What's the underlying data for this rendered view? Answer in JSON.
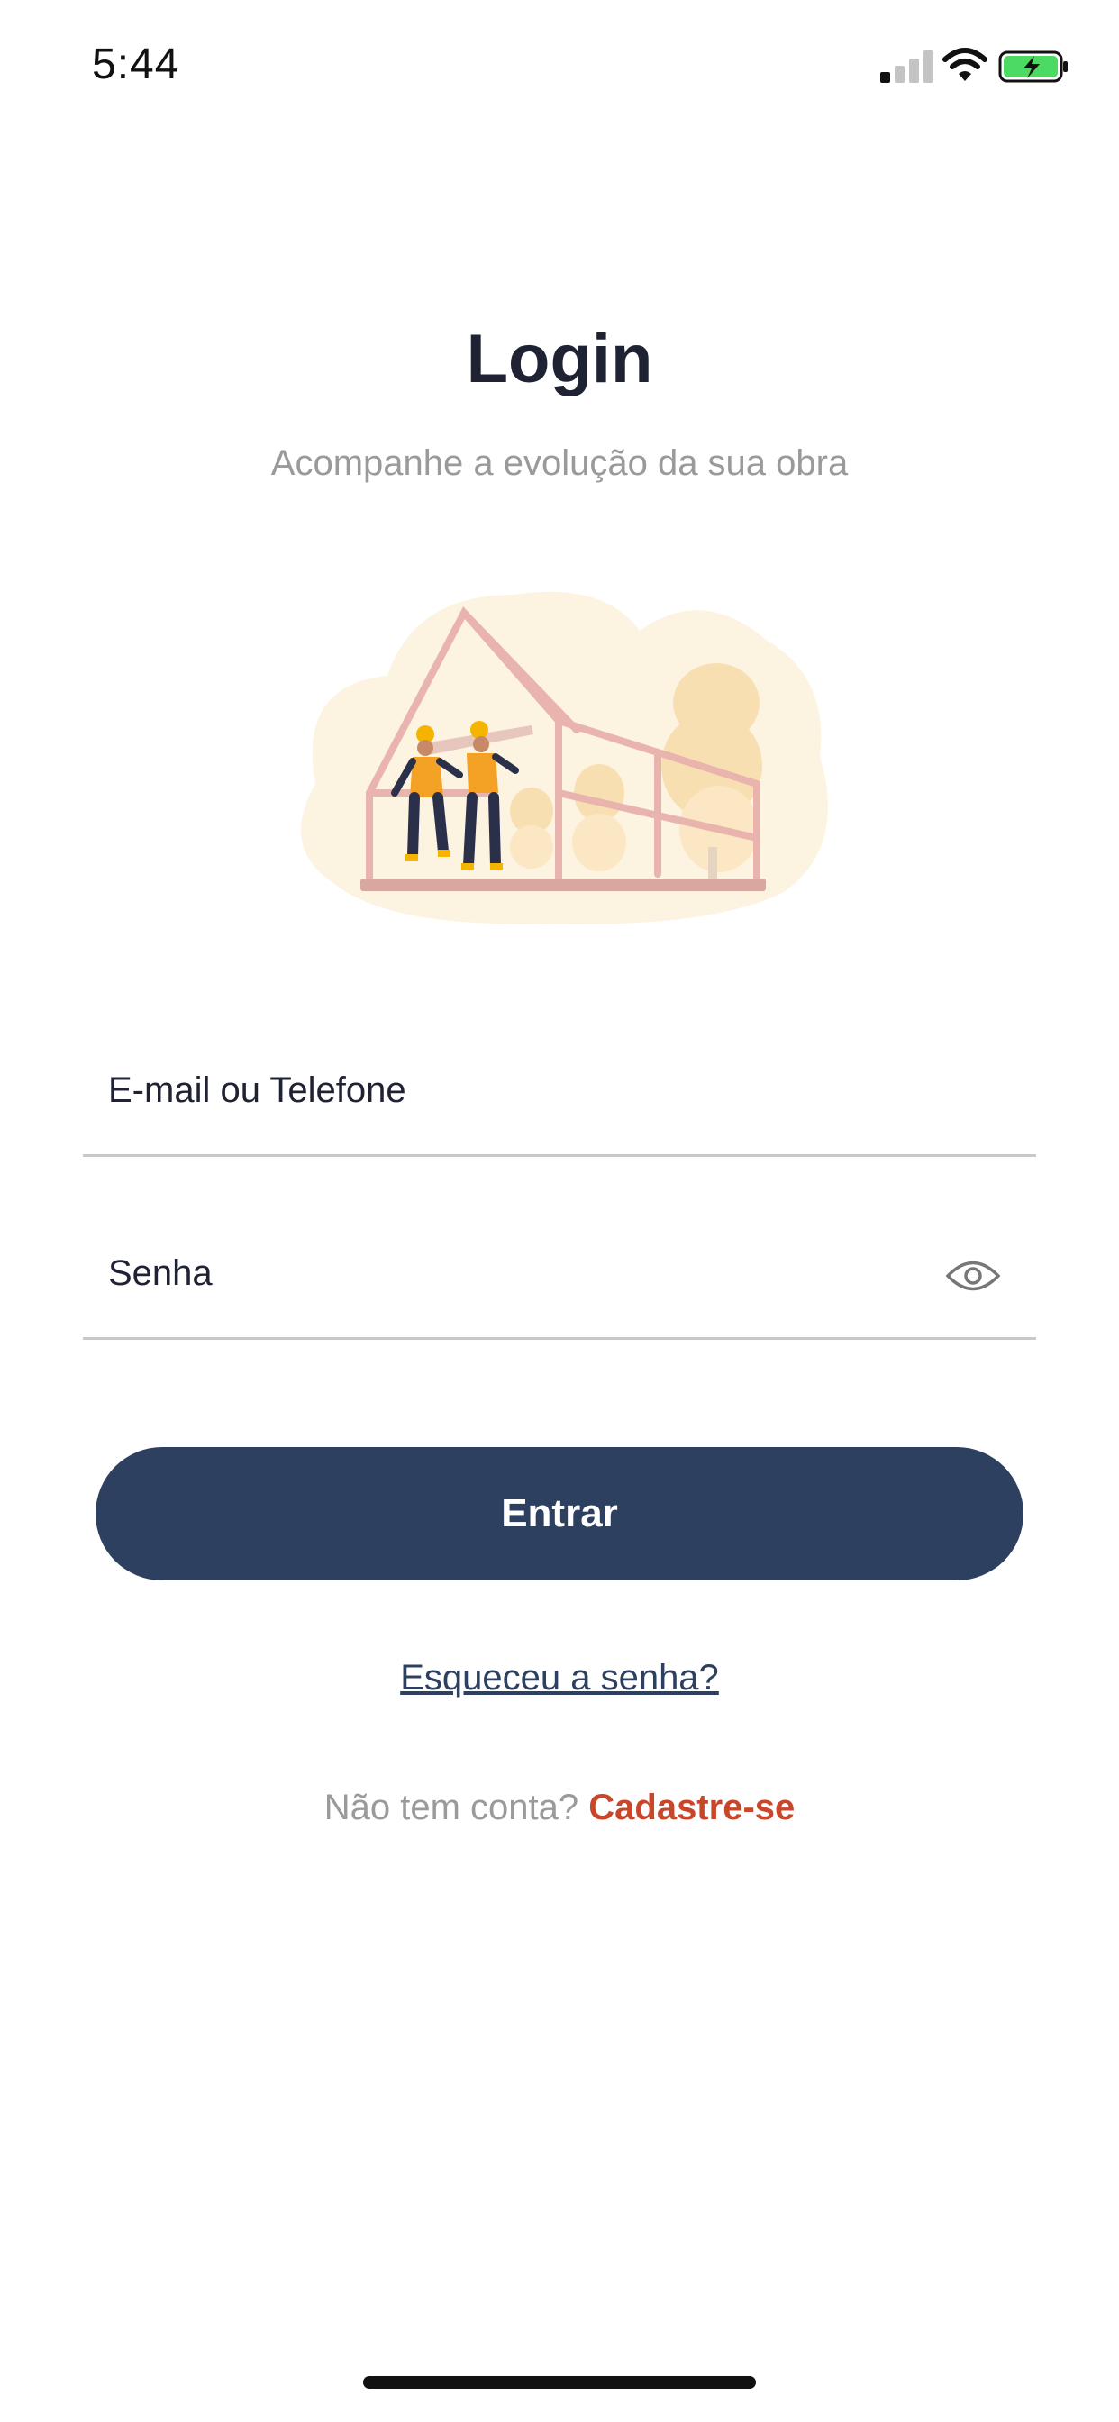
{
  "status_bar": {
    "time": "5:44",
    "icons": [
      "signal-icon",
      "wifi-icon",
      "battery-charging-icon"
    ]
  },
  "header": {
    "title": "Login",
    "subtitle": "Acompanhe a evolução da sua obra"
  },
  "form": {
    "email_label": "E-mail ou Telefone",
    "password_label": "Senha",
    "submit_label": "Entrar",
    "forgot_label": "Esqueceu a senha?"
  },
  "signup": {
    "prompt": "Não tem conta?",
    "link": "Cadastre-se"
  },
  "colors": {
    "primary": "#2d4060",
    "accent": "#c8472a",
    "muted_text": "#9a9a9a",
    "battery_green": "#4cd964"
  }
}
